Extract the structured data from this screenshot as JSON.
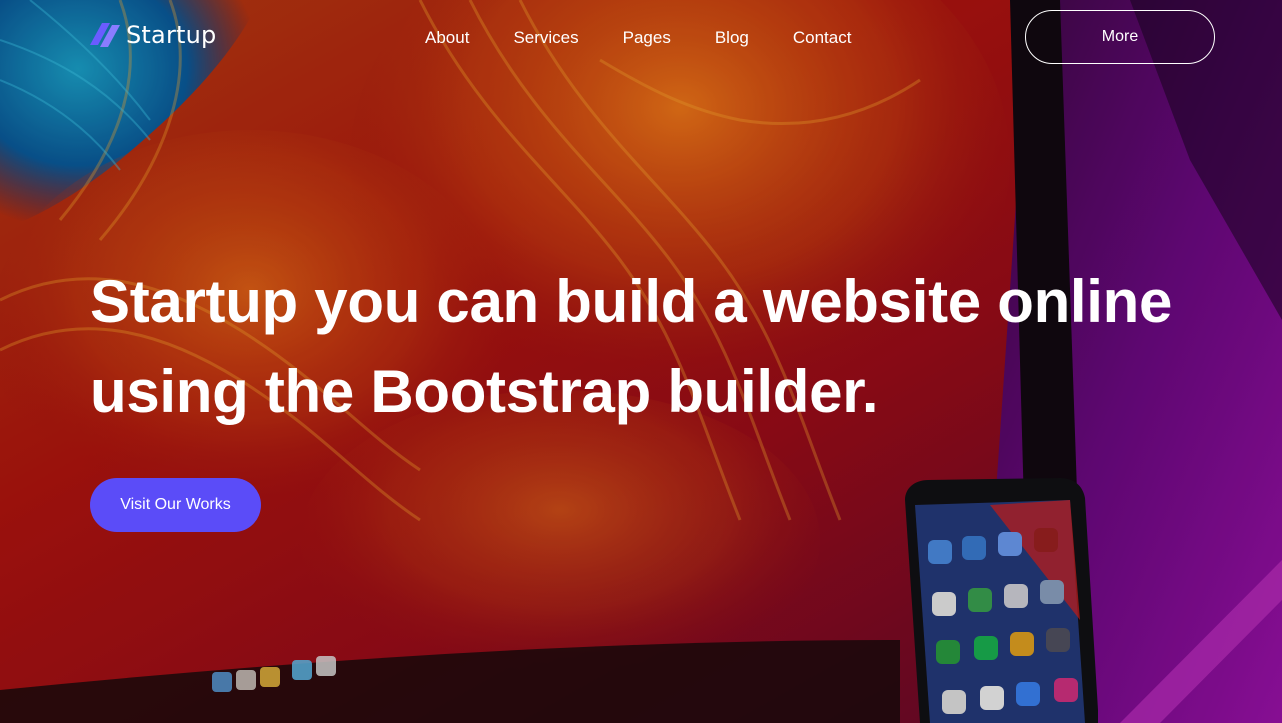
{
  "brand": {
    "name": "Startup",
    "logo_icon": "startup-logo-icon",
    "accent_color": "#5b4cf8"
  },
  "nav": {
    "items": [
      {
        "label": "About"
      },
      {
        "label": "Services"
      },
      {
        "label": "Pages"
      },
      {
        "label": "Blog"
      },
      {
        "label": "Contact"
      }
    ],
    "more_label": "More"
  },
  "hero": {
    "headline_line1": "Startup you can build a website online",
    "headline_line2": "using the Bootstrap builder.",
    "cta_label": "Visit Our Works",
    "background_image": "desktop monitor and smartphone with colorful wallpaper"
  }
}
